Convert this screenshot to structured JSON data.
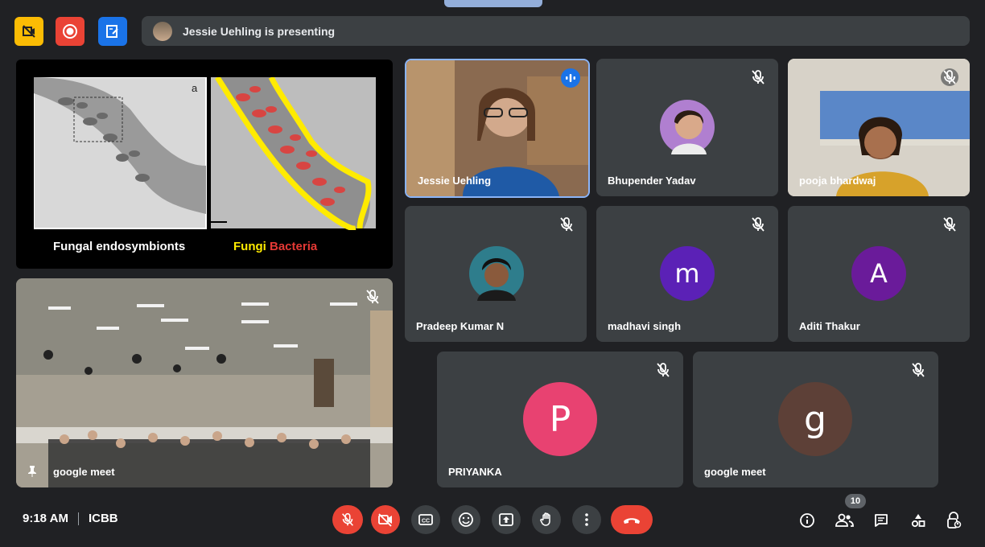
{
  "top_bar": {
    "presenting_text": "Jessie Uehling is presenting",
    "buttons": [
      {
        "icon": "no-video-rec-icon",
        "color": "#fbbc04"
      },
      {
        "icon": "record-icon",
        "color": "#ea4335"
      },
      {
        "icon": "whiteboard-icon",
        "color": "#1a73e8"
      }
    ]
  },
  "slide": {
    "caption_left": "Fungal endosymbionts",
    "caption_fungi": "Fungi",
    "caption_bacteria": "Bacteria",
    "panel_label": "a"
  },
  "pinned_tile": {
    "name": "google meet"
  },
  "participants": [
    {
      "name": "Jessie Uehling",
      "speaking": true
    },
    {
      "name": "Bhupender Yadav",
      "muted": true
    },
    {
      "name": "pooja bhardwaj",
      "muted": true
    },
    {
      "name": "Pradeep Kumar N",
      "muted": true
    },
    {
      "name": "madhavi singh",
      "muted": true,
      "initial": "m",
      "color": "#5b21b6"
    },
    {
      "name": "Aditi Thakur",
      "muted": true,
      "initial": "A",
      "color": "#6a1b9a"
    },
    {
      "name": "PRIYANKA",
      "muted": true,
      "initial": "P",
      "color": "#e84271"
    },
    {
      "name": "google meet",
      "muted": true,
      "initial": "g",
      "color": "#5d4037"
    }
  ],
  "bottom_bar": {
    "time": "9:18 AM",
    "meeting_code": "ICBB",
    "participant_count": "10"
  },
  "colors": {
    "background": "#202124",
    "tile": "#3c4043",
    "danger": "#ea4335",
    "active_border": "#8ab4f8"
  }
}
